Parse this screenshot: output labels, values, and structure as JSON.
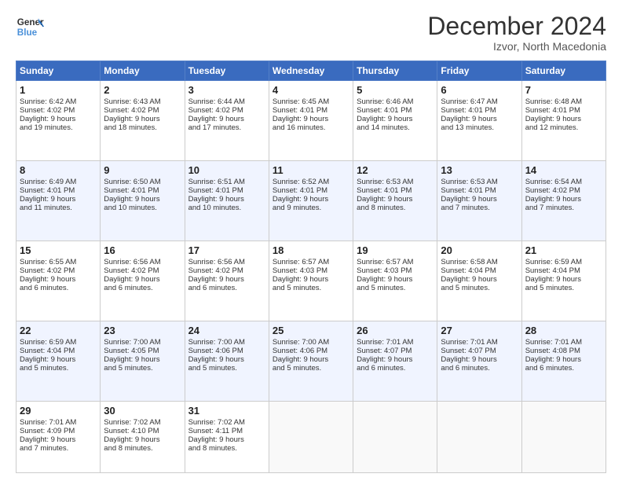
{
  "header": {
    "logo_line1": "General",
    "logo_line2": "Blue",
    "month": "December 2024",
    "location": "Izvor, North Macedonia"
  },
  "days_of_week": [
    "Sunday",
    "Monday",
    "Tuesday",
    "Wednesday",
    "Thursday",
    "Friday",
    "Saturday"
  ],
  "weeks": [
    [
      {
        "day": "1",
        "lines": [
          "Sunrise: 6:42 AM",
          "Sunset: 4:02 PM",
          "Daylight: 9 hours",
          "and 19 minutes."
        ]
      },
      {
        "day": "2",
        "lines": [
          "Sunrise: 6:43 AM",
          "Sunset: 4:02 PM",
          "Daylight: 9 hours",
          "and 18 minutes."
        ]
      },
      {
        "day": "3",
        "lines": [
          "Sunrise: 6:44 AM",
          "Sunset: 4:02 PM",
          "Daylight: 9 hours",
          "and 17 minutes."
        ]
      },
      {
        "day": "4",
        "lines": [
          "Sunrise: 6:45 AM",
          "Sunset: 4:01 PM",
          "Daylight: 9 hours",
          "and 16 minutes."
        ]
      },
      {
        "day": "5",
        "lines": [
          "Sunrise: 6:46 AM",
          "Sunset: 4:01 PM",
          "Daylight: 9 hours",
          "and 14 minutes."
        ]
      },
      {
        "day": "6",
        "lines": [
          "Sunrise: 6:47 AM",
          "Sunset: 4:01 PM",
          "Daylight: 9 hours",
          "and 13 minutes."
        ]
      },
      {
        "day": "7",
        "lines": [
          "Sunrise: 6:48 AM",
          "Sunset: 4:01 PM",
          "Daylight: 9 hours",
          "and 12 minutes."
        ]
      }
    ],
    [
      {
        "day": "8",
        "lines": [
          "Sunrise: 6:49 AM",
          "Sunset: 4:01 PM",
          "Daylight: 9 hours",
          "and 11 minutes."
        ]
      },
      {
        "day": "9",
        "lines": [
          "Sunrise: 6:50 AM",
          "Sunset: 4:01 PM",
          "Daylight: 9 hours",
          "and 10 minutes."
        ]
      },
      {
        "day": "10",
        "lines": [
          "Sunrise: 6:51 AM",
          "Sunset: 4:01 PM",
          "Daylight: 9 hours",
          "and 10 minutes."
        ]
      },
      {
        "day": "11",
        "lines": [
          "Sunrise: 6:52 AM",
          "Sunset: 4:01 PM",
          "Daylight: 9 hours",
          "and 9 minutes."
        ]
      },
      {
        "day": "12",
        "lines": [
          "Sunrise: 6:53 AM",
          "Sunset: 4:01 PM",
          "Daylight: 9 hours",
          "and 8 minutes."
        ]
      },
      {
        "day": "13",
        "lines": [
          "Sunrise: 6:53 AM",
          "Sunset: 4:01 PM",
          "Daylight: 9 hours",
          "and 7 minutes."
        ]
      },
      {
        "day": "14",
        "lines": [
          "Sunrise: 6:54 AM",
          "Sunset: 4:02 PM",
          "Daylight: 9 hours",
          "and 7 minutes."
        ]
      }
    ],
    [
      {
        "day": "15",
        "lines": [
          "Sunrise: 6:55 AM",
          "Sunset: 4:02 PM",
          "Daylight: 9 hours",
          "and 6 minutes."
        ]
      },
      {
        "day": "16",
        "lines": [
          "Sunrise: 6:56 AM",
          "Sunset: 4:02 PM",
          "Daylight: 9 hours",
          "and 6 minutes."
        ]
      },
      {
        "day": "17",
        "lines": [
          "Sunrise: 6:56 AM",
          "Sunset: 4:02 PM",
          "Daylight: 9 hours",
          "and 6 minutes."
        ]
      },
      {
        "day": "18",
        "lines": [
          "Sunrise: 6:57 AM",
          "Sunset: 4:03 PM",
          "Daylight: 9 hours",
          "and 5 minutes."
        ]
      },
      {
        "day": "19",
        "lines": [
          "Sunrise: 6:57 AM",
          "Sunset: 4:03 PM",
          "Daylight: 9 hours",
          "and 5 minutes."
        ]
      },
      {
        "day": "20",
        "lines": [
          "Sunrise: 6:58 AM",
          "Sunset: 4:04 PM",
          "Daylight: 9 hours",
          "and 5 minutes."
        ]
      },
      {
        "day": "21",
        "lines": [
          "Sunrise: 6:59 AM",
          "Sunset: 4:04 PM",
          "Daylight: 9 hours",
          "and 5 minutes."
        ]
      }
    ],
    [
      {
        "day": "22",
        "lines": [
          "Sunrise: 6:59 AM",
          "Sunset: 4:04 PM",
          "Daylight: 9 hours",
          "and 5 minutes."
        ]
      },
      {
        "day": "23",
        "lines": [
          "Sunrise: 7:00 AM",
          "Sunset: 4:05 PM",
          "Daylight: 9 hours",
          "and 5 minutes."
        ]
      },
      {
        "day": "24",
        "lines": [
          "Sunrise: 7:00 AM",
          "Sunset: 4:06 PM",
          "Daylight: 9 hours",
          "and 5 minutes."
        ]
      },
      {
        "day": "25",
        "lines": [
          "Sunrise: 7:00 AM",
          "Sunset: 4:06 PM",
          "Daylight: 9 hours",
          "and 5 minutes."
        ]
      },
      {
        "day": "26",
        "lines": [
          "Sunrise: 7:01 AM",
          "Sunset: 4:07 PM",
          "Daylight: 9 hours",
          "and 6 minutes."
        ]
      },
      {
        "day": "27",
        "lines": [
          "Sunrise: 7:01 AM",
          "Sunset: 4:07 PM",
          "Daylight: 9 hours",
          "and 6 minutes."
        ]
      },
      {
        "day": "28",
        "lines": [
          "Sunrise: 7:01 AM",
          "Sunset: 4:08 PM",
          "Daylight: 9 hours",
          "and 6 minutes."
        ]
      }
    ],
    [
      {
        "day": "29",
        "lines": [
          "Sunrise: 7:01 AM",
          "Sunset: 4:09 PM",
          "Daylight: 9 hours",
          "and 7 minutes."
        ]
      },
      {
        "day": "30",
        "lines": [
          "Sunrise: 7:02 AM",
          "Sunset: 4:10 PM",
          "Daylight: 9 hours",
          "and 8 minutes."
        ]
      },
      {
        "day": "31",
        "lines": [
          "Sunrise: 7:02 AM",
          "Sunset: 4:11 PM",
          "Daylight: 9 hours",
          "and 8 minutes."
        ]
      },
      null,
      null,
      null,
      null
    ]
  ]
}
